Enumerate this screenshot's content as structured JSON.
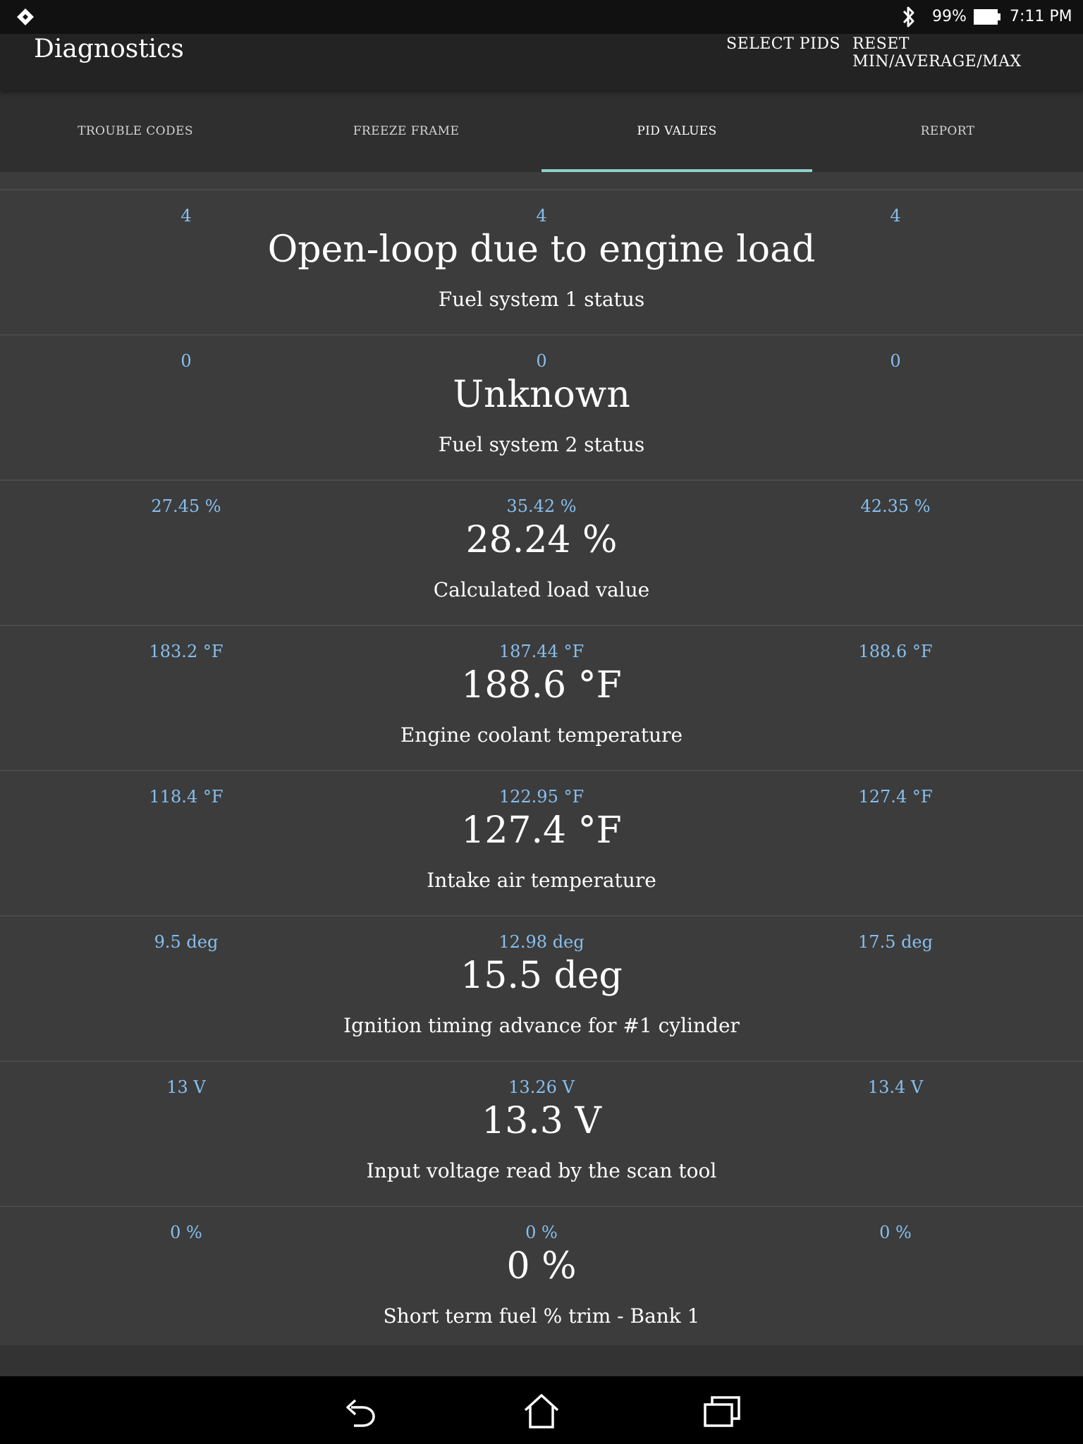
{
  "status_bar": {
    "battery_percent": "99%",
    "time": "7:11 PM",
    "icons": [
      "app-logo-icon",
      "bluetooth-icon",
      "battery-icon"
    ]
  },
  "app_bar": {
    "title": "Diagnostics",
    "select_pids_label": "SELECT PIDS",
    "reset_label": "RESET MIN/AVERAGE/MAX"
  },
  "tabs": [
    {
      "label": "TROUBLE CODES"
    },
    {
      "label": "FREEZE FRAME"
    },
    {
      "label": "PID VALUES"
    },
    {
      "label": "REPORT"
    }
  ],
  "active_tab": "PID VALUES",
  "colors": {
    "accent_indicator": "#8ed1cc",
    "stat_text": "#87bfef",
    "background": "#3c3c3c"
  },
  "pids": [
    {
      "min": "4",
      "avg": "4",
      "max": "4",
      "value": "Open-loop due to engine load",
      "name": "Fuel system 1 status"
    },
    {
      "min": "0",
      "avg": "0",
      "max": "0",
      "value": "Unknown",
      "name": "Fuel system 2 status"
    },
    {
      "min": "27.45 %",
      "avg": "35.42 %",
      "max": "42.35 %",
      "value": "28.24 %",
      "name": "Calculated load value"
    },
    {
      "min": "183.2 °F",
      "avg": "187.44 °F",
      "max": "188.6 °F",
      "value": "188.6 °F",
      "name": "Engine coolant temperature"
    },
    {
      "min": "118.4 °F",
      "avg": "122.95 °F",
      "max": "127.4 °F",
      "value": "127.4 °F",
      "name": "Intake air temperature"
    },
    {
      "min": "9.5 deg",
      "avg": "12.98 deg",
      "max": "17.5 deg",
      "value": "15.5 deg",
      "name": "Ignition timing advance for #1 cylinder"
    },
    {
      "min": "13 V",
      "avg": "13.26 V",
      "max": "13.4 V",
      "value": "13.3 V",
      "name": "Input voltage read by the scan tool"
    },
    {
      "min": "0 %",
      "avg": "0 %",
      "max": "0 %",
      "value": "0 %",
      "name": "Short term fuel % trim - Bank 1"
    }
  ],
  "nav_bar": {
    "icons": [
      "back-icon",
      "home-icon",
      "recent-apps-icon"
    ]
  }
}
